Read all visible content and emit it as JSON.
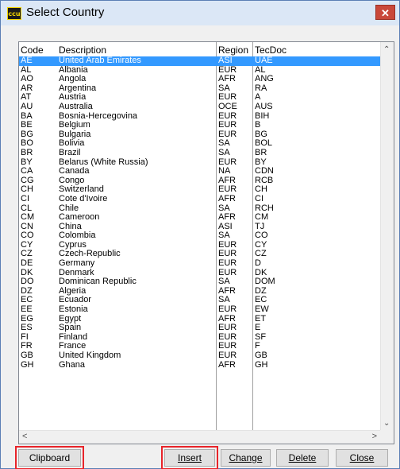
{
  "window": {
    "title": "Select Country",
    "app_icon_text": "ccu",
    "close_glyph": "✕"
  },
  "table": {
    "headers": {
      "code": "Code",
      "description": "Description",
      "region": "Region",
      "tecdoc": "TecDoc"
    },
    "selected_index": 0,
    "rows": [
      {
        "code": "AE",
        "description": "United Arab Emirates",
        "region": "ASI",
        "tecdoc": "UAE"
      },
      {
        "code": "AL",
        "description": "Albania",
        "region": "EUR",
        "tecdoc": "AL"
      },
      {
        "code": "AO",
        "description": "Angola",
        "region": "AFR",
        "tecdoc": "ANG"
      },
      {
        "code": "AR",
        "description": "Argentina",
        "region": "SA",
        "tecdoc": "RA"
      },
      {
        "code": "AT",
        "description": "Austria",
        "region": "EUR",
        "tecdoc": "A"
      },
      {
        "code": "AU",
        "description": "Australia",
        "region": "OCE",
        "tecdoc": "AUS"
      },
      {
        "code": "BA",
        "description": "Bosnia-Hercegovina",
        "region": "EUR",
        "tecdoc": "BIH"
      },
      {
        "code": "BE",
        "description": "Belgium",
        "region": "EUR",
        "tecdoc": "B"
      },
      {
        "code": "BG",
        "description": "Bulgaria",
        "region": "EUR",
        "tecdoc": "BG"
      },
      {
        "code": "BO",
        "description": "Bolivia",
        "region": "SA",
        "tecdoc": "BOL"
      },
      {
        "code": "BR",
        "description": "Brazil",
        "region": "SA",
        "tecdoc": "BR"
      },
      {
        "code": "BY",
        "description": "Belarus (White Russia)",
        "region": "EUR",
        "tecdoc": "BY"
      },
      {
        "code": "CA",
        "description": "Canada",
        "region": "NA",
        "tecdoc": "CDN"
      },
      {
        "code": "CG",
        "description": "Congo",
        "region": "AFR",
        "tecdoc": "RCB"
      },
      {
        "code": "CH",
        "description": "Switzerland",
        "region": "EUR",
        "tecdoc": "CH"
      },
      {
        "code": "CI",
        "description": "Cote d'Ivoire",
        "region": "AFR",
        "tecdoc": "CI"
      },
      {
        "code": "CL",
        "description": "Chile",
        "region": "SA",
        "tecdoc": "RCH"
      },
      {
        "code": "CM",
        "description": "Cameroon",
        "region": "AFR",
        "tecdoc": "CM"
      },
      {
        "code": "CN",
        "description": "China",
        "region": "ASI",
        "tecdoc": "TJ"
      },
      {
        "code": "CO",
        "description": "Colombia",
        "region": "SA",
        "tecdoc": "CO"
      },
      {
        "code": "CY",
        "description": "Cyprus",
        "region": "EUR",
        "tecdoc": "CY"
      },
      {
        "code": "CZ",
        "description": "Czech-Republic",
        "region": "EUR",
        "tecdoc": "CZ"
      },
      {
        "code": "DE",
        "description": "Germany",
        "region": "EUR",
        "tecdoc": "D"
      },
      {
        "code": "DK",
        "description": "Denmark",
        "region": "EUR",
        "tecdoc": "DK"
      },
      {
        "code": "DO",
        "description": "Dominican Republic",
        "region": "SA",
        "tecdoc": "DOM"
      },
      {
        "code": "DZ",
        "description": "Algeria",
        "region": "AFR",
        "tecdoc": "DZ"
      },
      {
        "code": "EC",
        "description": "Ecuador",
        "region": "SA",
        "tecdoc": "EC"
      },
      {
        "code": "EE",
        "description": "Estonia",
        "region": "EUR",
        "tecdoc": "EW"
      },
      {
        "code": "EG",
        "description": "Egypt",
        "region": "AFR",
        "tecdoc": "ET"
      },
      {
        "code": "ES",
        "description": "Spain",
        "region": "EUR",
        "tecdoc": "E"
      },
      {
        "code": "FI",
        "description": "Finland",
        "region": "EUR",
        "tecdoc": "SF"
      },
      {
        "code": "FR",
        "description": "France",
        "region": "EUR",
        "tecdoc": "F"
      },
      {
        "code": "GB",
        "description": "United Kingdom",
        "region": "EUR",
        "tecdoc": "GB"
      },
      {
        "code": "GH",
        "description": "Ghana",
        "region": "AFR",
        "tecdoc": "GH"
      }
    ]
  },
  "scrollbars": {
    "up": "⌃",
    "down": "⌄",
    "left": "<",
    "right": ">"
  },
  "buttons": {
    "clipboard": "Clipboard",
    "insert": "Insert",
    "change": "Change",
    "delete": "Delete",
    "close": "Close"
  },
  "colors": {
    "selection": "#3399ff",
    "highlight_outline": "#e8242a"
  }
}
